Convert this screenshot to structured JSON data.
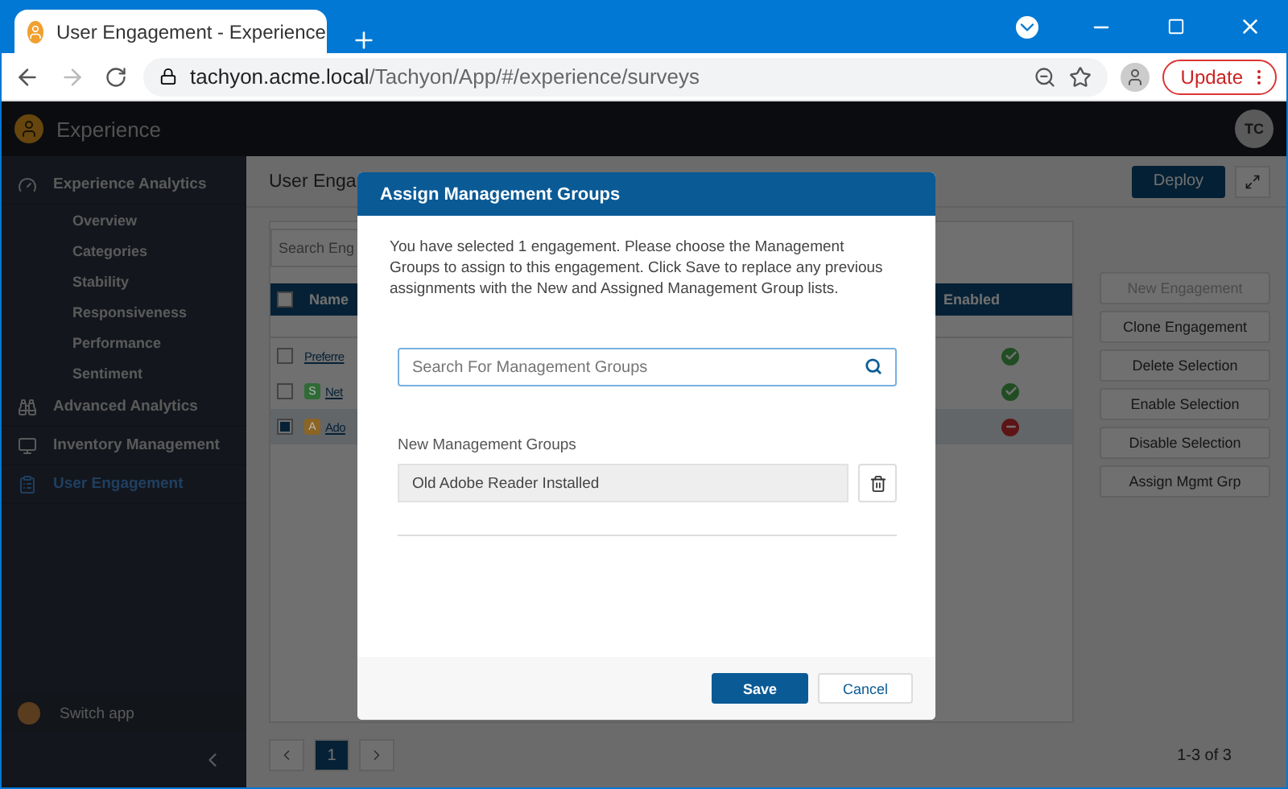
{
  "browser": {
    "tab_title": "User Engagement - Experience",
    "url_host": "tachyon.acme.local",
    "url_path": "/Tachyon/App/#/experience/surveys",
    "update_label": "Update"
  },
  "app": {
    "name": "Experience",
    "avatar_initials": "TC"
  },
  "sidebar": {
    "items": [
      {
        "label": "Experience Analytics",
        "selected": false,
        "children": [
          {
            "label": "Overview"
          },
          {
            "label": "Categories"
          },
          {
            "label": "Stability"
          },
          {
            "label": "Responsiveness"
          },
          {
            "label": "Performance"
          },
          {
            "label": "Sentiment"
          }
        ]
      },
      {
        "label": "Advanced Analytics",
        "selected": false
      },
      {
        "label": "Inventory Management",
        "selected": false
      },
      {
        "label": "User Engagement",
        "selected": true
      }
    ],
    "switch_app": "Switch app"
  },
  "page": {
    "title": "User Enga",
    "deploy_label": "Deploy",
    "search_placeholder": "Search Eng",
    "table": {
      "header_checked": false,
      "columns": [
        "Name",
        "Enabled"
      ],
      "rows": [
        {
          "checked": false,
          "selected": false,
          "name": "Preferre",
          "enabled": true
        },
        {
          "checked": false,
          "selected": false,
          "badge": {
            "text": "S",
            "color": "#2f6b36"
          },
          "name": "Net",
          "enabled": true
        },
        {
          "checked": true,
          "selected": true,
          "badge": {
            "text": "A",
            "color": "#8c6424"
          },
          "name": "Ado",
          "enabled": false
        }
      ]
    },
    "actions": [
      {
        "label": "New Engagement",
        "disabled": true
      },
      {
        "label": "Clone Engagement",
        "disabled": false
      },
      {
        "label": "Delete Selection",
        "disabled": false
      },
      {
        "label": "Enable Selection",
        "disabled": false
      },
      {
        "label": "Disable Selection",
        "disabled": false
      },
      {
        "label": "Assign Mgmt Grp",
        "disabled": false
      }
    ],
    "pagination": {
      "pages": [
        {
          "label": "1",
          "selected": true
        }
      ],
      "summary": "1-3 of 3"
    }
  },
  "modal": {
    "title": "Assign Management Groups",
    "message": "You have selected 1 engagement. Please choose the Management Groups to assign to this engagement. Click Save to replace any previous assignments with the New and Assigned Management Group lists.",
    "search_placeholder": "Search For Management Groups",
    "list_label": "New Management Groups",
    "groups": [
      {
        "name": "Old Adobe Reader Installed"
      }
    ],
    "save_label": "Save",
    "cancel_label": "Cancel"
  }
}
